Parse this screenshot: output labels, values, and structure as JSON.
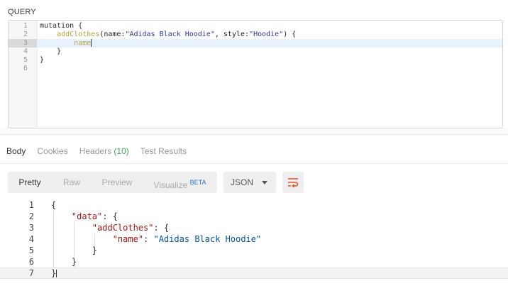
{
  "query_section": {
    "label": "QUERY",
    "lines": [
      {
        "num": "1",
        "text": "mutation {"
      },
      {
        "num": "2",
        "parts": [
          "    ",
          "addClothes",
          "(name:",
          "\"Adidas Black Hoodie\"",
          ", style:",
          "\"Hoodie\"",
          ") {"
        ]
      },
      {
        "num": "3",
        "indent": "        ",
        "field": "name"
      },
      {
        "num": "4",
        "text": "    }"
      },
      {
        "num": "5",
        "text": "}"
      },
      {
        "num": "6",
        "text": ""
      }
    ]
  },
  "response_tabs": [
    {
      "label": "Body"
    },
    {
      "label": "Cookies"
    },
    {
      "label": "Headers",
      "count": "(10)"
    },
    {
      "label": "Test Results"
    }
  ],
  "view_modes": {
    "pretty": "Pretty",
    "raw": "Raw",
    "preview": "Preview",
    "visualize": "Visualize",
    "visualize_badge": "BETA"
  },
  "format_select": {
    "selected": "JSON"
  },
  "icons": {
    "wrap": "wrap-lines-icon",
    "chevron": "chevron-down-icon"
  },
  "colors": {
    "accent": "#e8572c"
  },
  "response_body": {
    "lines": [
      {
        "num": "1",
        "code": "{"
      },
      {
        "num": "2",
        "indent": "    ",
        "key": "\"data\"",
        "rest": ": {"
      },
      {
        "num": "3",
        "indent": "        ",
        "key": "\"addClothes\"",
        "rest": ": {"
      },
      {
        "num": "4",
        "indent": "            ",
        "key": "\"name\"",
        "sep": ": ",
        "value": "\"Adidas Black Hoodie\""
      },
      {
        "num": "5",
        "code": "        }"
      },
      {
        "num": "6",
        "code": "    }"
      },
      {
        "num": "7",
        "code": "}"
      }
    ]
  }
}
